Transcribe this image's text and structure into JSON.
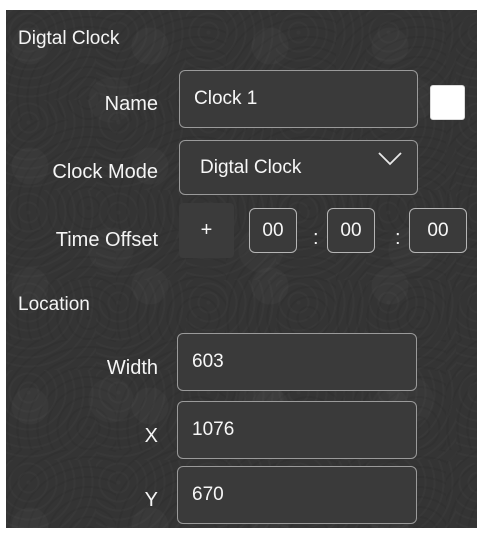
{
  "section_clock": {
    "title": "Digtal Clock"
  },
  "name_row": {
    "label": "Name",
    "value": "Clock 1",
    "checkbox_checked": false
  },
  "mode_row": {
    "label": "Clock Mode",
    "selected": "Digtal Clock",
    "chevron_icon": "chevron-down-icon"
  },
  "offset_row": {
    "label": "Time Offset",
    "sign": "+",
    "hours": "00",
    "minutes": "00",
    "seconds": "00",
    "separator": ":"
  },
  "section_location": {
    "title": "Location"
  },
  "width_row": {
    "label": "Width",
    "value": "603"
  },
  "x_row": {
    "label": "X",
    "value": "1076"
  },
  "y_row": {
    "label": "Y",
    "value": "670"
  }
}
